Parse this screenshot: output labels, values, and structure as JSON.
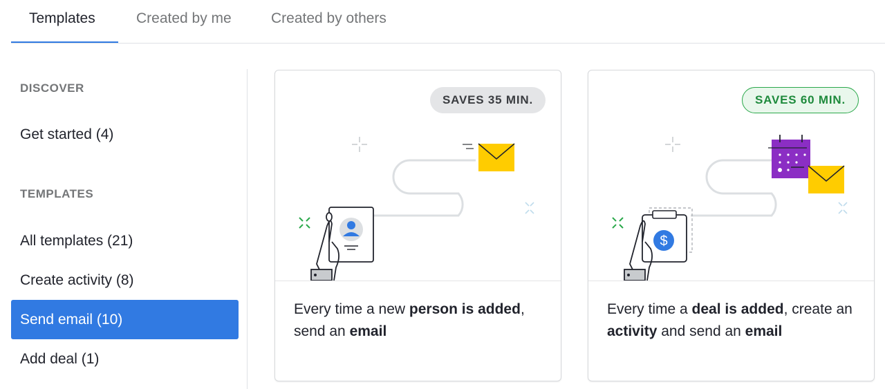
{
  "tabs": [
    {
      "label": "Templates",
      "active": true
    },
    {
      "label": "Created by me",
      "active": false
    },
    {
      "label": "Created by others",
      "active": false
    }
  ],
  "sidebar": {
    "discover_heading": "DISCOVER",
    "templates_heading": "TEMPLATES",
    "items": [
      {
        "label": "Get started (4)",
        "selected": false
      },
      {
        "label": "All templates (21)",
        "selected": false
      },
      {
        "label": "Create activity (8)",
        "selected": false
      },
      {
        "label": "Send email (10)",
        "selected": true
      },
      {
        "label": "Add deal (1)",
        "selected": false
      }
    ]
  },
  "cards": [
    {
      "badge": "SAVES 35 MIN.",
      "badge_style": "gray",
      "icons": [
        "contact-card-icon",
        "envelope-icon"
      ],
      "text_parts": [
        {
          "t": "Every time a new ",
          "bold": false
        },
        {
          "t": "person is added",
          "bold": true
        },
        {
          "t": ", send an ",
          "bold": false
        },
        {
          "t": "email",
          "bold": true
        }
      ]
    },
    {
      "badge": "SAVES 60 MIN.",
      "badge_style": "green",
      "icons": [
        "clipboard-dollar-icon",
        "calendar-icon",
        "envelope-icon"
      ],
      "text_parts": [
        {
          "t": "Every time a ",
          "bold": false
        },
        {
          "t": "deal is added",
          "bold": true
        },
        {
          "t": ", create an ",
          "bold": false
        },
        {
          "t": "activity",
          "bold": true
        },
        {
          "t": " and send an ",
          "bold": false
        },
        {
          "t": "email",
          "bold": true
        }
      ]
    }
  ],
  "colors": {
    "accent_blue": "#317ae2",
    "envelope_yellow": "#ffcc00",
    "calendar_purple": "#8b2ec4",
    "sparkle_green": "#2aa84a",
    "badge_green": "#1e8a3c"
  }
}
